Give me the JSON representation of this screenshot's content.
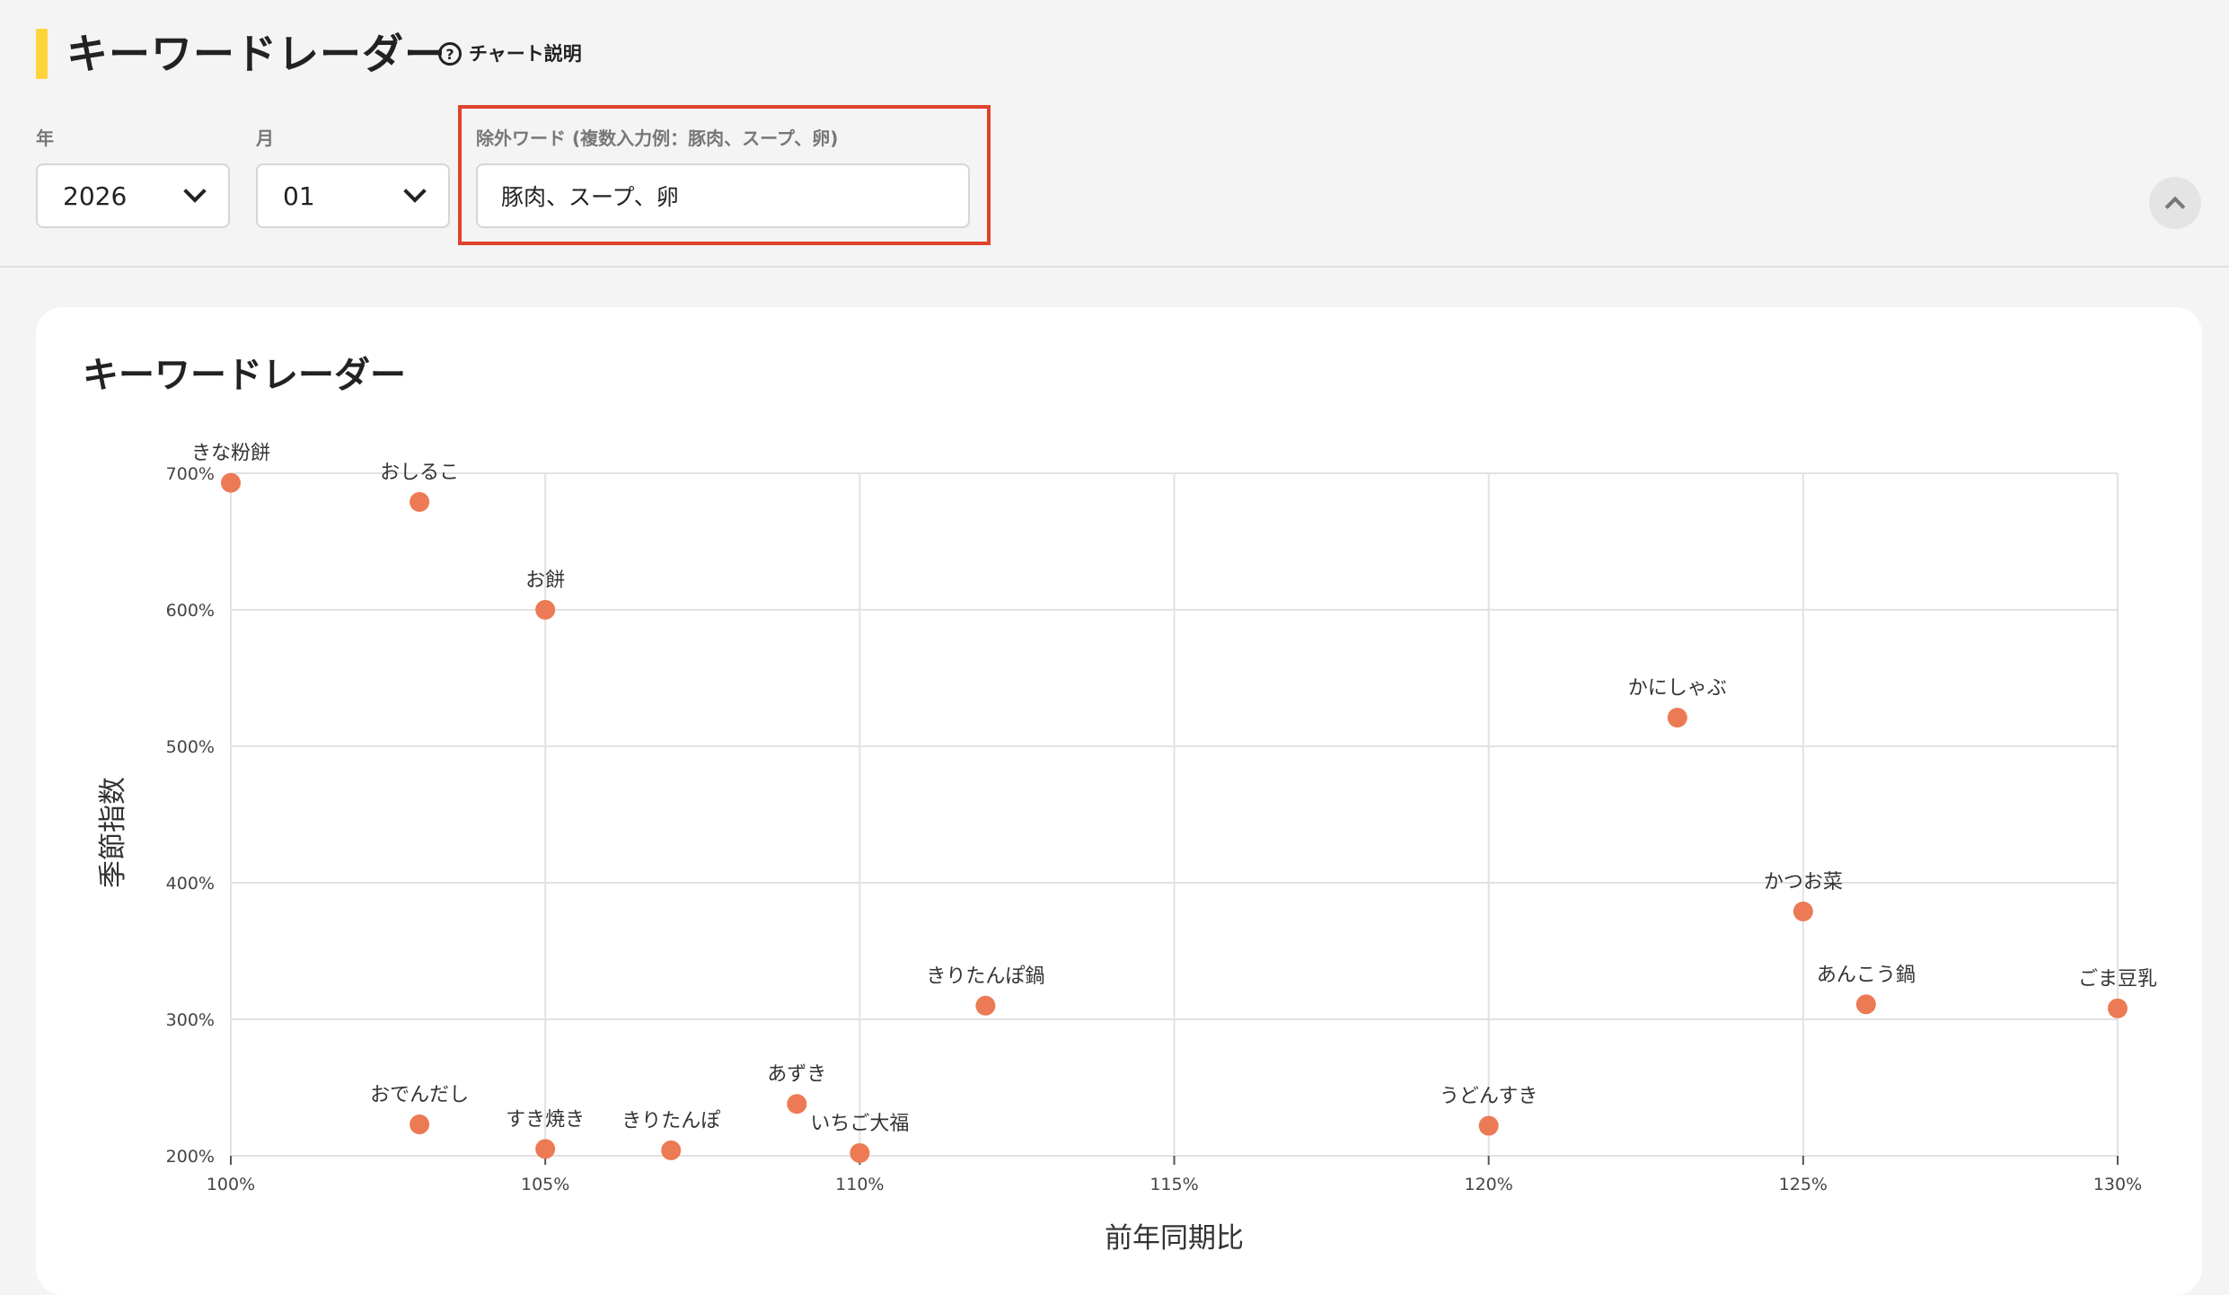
{
  "header": {
    "title": "キーワードレーダー",
    "help_label": "チャート説明"
  },
  "filters": {
    "year_label": "年",
    "year_value": "2026",
    "month_label": "月",
    "month_value": "01",
    "exclude_label": "除外ワード (複数入力例：豚肉、スープ、卵)",
    "exclude_value": "豚肉、スープ、卵"
  },
  "card": {
    "title": "キーワードレーダー"
  },
  "colors": {
    "accent": "#ffd43b",
    "highlight_border": "#e0432a",
    "point": "#ec7a54"
  },
  "chart_data": {
    "type": "scatter",
    "xlabel": "前年同期比",
    "ylabel": "季節指数",
    "xlim": [
      100,
      130
    ],
    "ylim": [
      200,
      700
    ],
    "xticks": [
      100,
      105,
      110,
      115,
      120,
      125,
      130
    ],
    "yticks": [
      200,
      300,
      400,
      500,
      600,
      700
    ],
    "x_tick_format": "%",
    "y_tick_format": "%",
    "grid": true,
    "points": [
      {
        "label": "きな粉餅",
        "x": 100,
        "y": 693
      },
      {
        "label": "おしるこ",
        "x": 103,
        "y": 679
      },
      {
        "label": "お餅",
        "x": 105,
        "y": 600
      },
      {
        "label": "かにしゃぶ",
        "x": 123,
        "y": 521
      },
      {
        "label": "かつお菜",
        "x": 125,
        "y": 379
      },
      {
        "label": "あんこう鍋",
        "x": 126,
        "y": 311
      },
      {
        "label": "ごま豆乳",
        "x": 130,
        "y": 308
      },
      {
        "label": "きりたんぽ鍋",
        "x": 112,
        "y": 310
      },
      {
        "label": "あずき",
        "x": 109,
        "y": 238
      },
      {
        "label": "おでんだし",
        "x": 103,
        "y": 223
      },
      {
        "label": "すき焼き",
        "x": 105,
        "y": 205
      },
      {
        "label": "きりたんぽ",
        "x": 107,
        "y": 204
      },
      {
        "label": "いちご大福",
        "x": 110,
        "y": 202
      },
      {
        "label": "うどんすき",
        "x": 120,
        "y": 222
      }
    ]
  }
}
